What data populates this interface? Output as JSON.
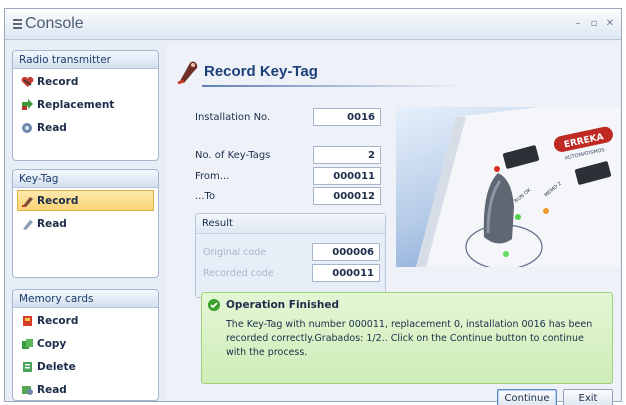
{
  "window": {
    "title": "Console"
  },
  "sidebar": {
    "radio": {
      "title": "Radio transmitter",
      "items": [
        "Record",
        "Replacement",
        "Read"
      ]
    },
    "keytag": {
      "title": "Key-Tag",
      "items": [
        "Record",
        "Read"
      ],
      "active": "Record"
    },
    "memory": {
      "title": "Memory cards",
      "items": [
        "Record",
        "Copy",
        "Delete",
        "Read"
      ]
    }
  },
  "main": {
    "title": "Record Key-Tag",
    "fields": {
      "installation_label": "Installation No.",
      "installation_value": "0016",
      "count_label": "No. of Key-Tags",
      "count_value": "2",
      "from_label": "From...",
      "from_value": "000011",
      "to_label": "...To",
      "to_value": "000012"
    },
    "result": {
      "title": "Result",
      "original_label": "Original code",
      "original_value": "000006",
      "recorded_label": "Recorded code",
      "recorded_value": "000011"
    },
    "photo": {
      "brand": "ERREKA",
      "sub": "AUTOMATISMOS",
      "led1": "RUN OK",
      "led2": "MEMO 2"
    },
    "status": {
      "title": "Operation Finished",
      "message": "The Key-Tag with number 000011, replacement 0, installation 0016 has been recorded correctly.Grabados: 1/2.. Click on the Continue button to continue with the process."
    },
    "buttons": {
      "continue": "Continue",
      "exit": "Exit"
    }
  },
  "colors": {
    "accent": "#1d3f7a",
    "success": "#3aa12e",
    "selection": "#f9d273"
  }
}
